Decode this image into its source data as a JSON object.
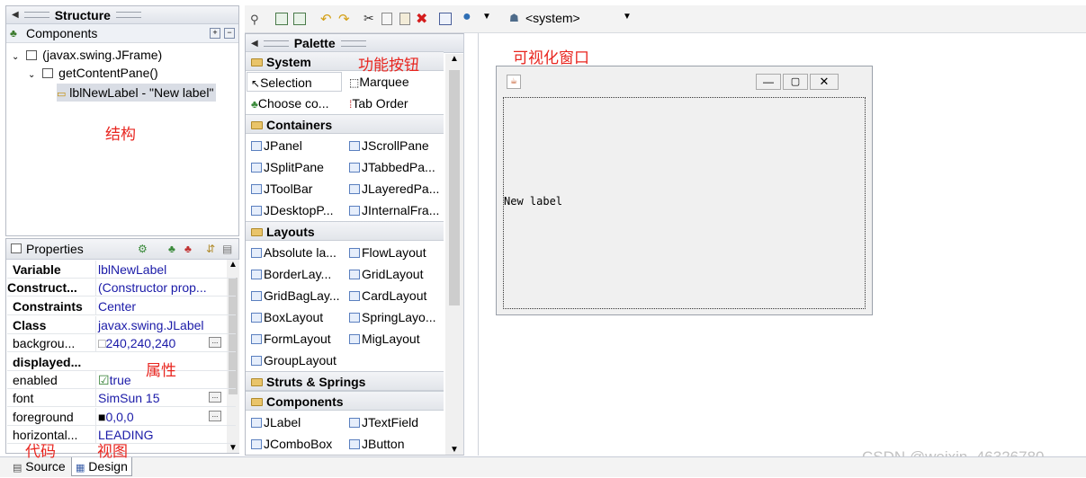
{
  "structure": {
    "title": "Structure",
    "components_label": "Components",
    "tree": [
      "(javax.swing.JFrame)",
      "getContentPane()",
      "lblNewLabel - \"New label\""
    ],
    "annotation": "结构"
  },
  "properties": {
    "title": "Properties",
    "annotation": "属性",
    "rows": [
      {
        "key": "Variable",
        "value": "lblNewLabel",
        "bold": true
      },
      {
        "key": "Construct...",
        "value": "(Constructor prop...",
        "bold": true
      },
      {
        "key": "Constraints",
        "value": "Center",
        "bold": true
      },
      {
        "key": "Class",
        "value": "javax.swing.JLabel",
        "bold": true
      },
      {
        "key": "backgrou...",
        "value": "240,240,240",
        "bold": false
      },
      {
        "key": "displayed...",
        "value": "",
        "bold": true
      },
      {
        "key": "enabled",
        "value": "true",
        "bold": false
      },
      {
        "key": "font",
        "value": "SimSun 15",
        "bold": false
      },
      {
        "key": "foreground",
        "value": "0,0,0",
        "bold": false
      },
      {
        "key": "horizontal...",
        "value": "LEADING",
        "bold": false
      }
    ]
  },
  "toolbar": {
    "system_label": "<system>"
  },
  "palette": {
    "title": "Palette",
    "annotation": "功能按钮",
    "system_cat": "System",
    "system_items": [
      "Selection",
      "Marquee",
      "Choose co...",
      "Tab Order"
    ],
    "containers_cat": "Containers",
    "containers_items": [
      "JPanel",
      "JScrollPane",
      "JSplitPane",
      "JTabbedPa...",
      "JToolBar",
      "JLayeredPa...",
      "JDesktopP...",
      "JInternalFra..."
    ],
    "layouts_cat": "Layouts",
    "layouts_items": [
      "Absolute la...",
      "FlowLayout",
      "BorderLay...",
      "GridLayout",
      "GridBagLay...",
      "CardLayout",
      "BoxLayout",
      "SpringLayo...",
      "FormLayout",
      "MigLayout",
      "GroupLayout"
    ],
    "struts_cat": "Struts & Springs",
    "components_cat": "Components",
    "components_items": [
      "JLabel",
      "JTextField",
      "JComboBox",
      "JButton"
    ]
  },
  "canvas": {
    "annotation": "可视化窗口",
    "label_text": "New label"
  },
  "tabs": {
    "source": "Source",
    "design": "Design",
    "source_annotation": "代码",
    "design_annotation": "视图"
  },
  "watermark": "CSDN @weixin_46326780"
}
